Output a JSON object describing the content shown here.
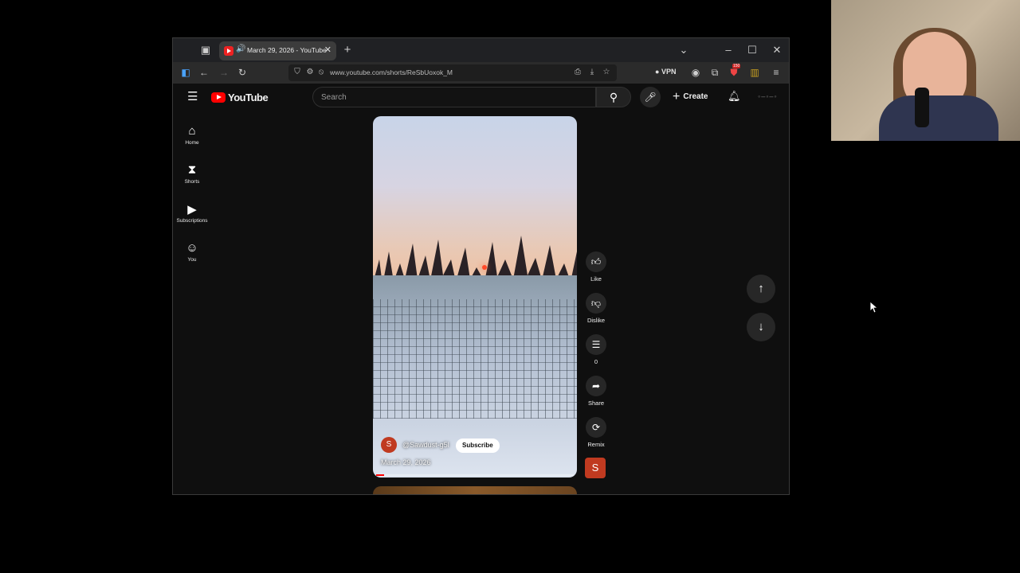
{
  "browser": {
    "tab_title": "March 29, 2026 - YouTube",
    "url": "www.youtube.com/shorts/ReSbUoxok_M",
    "vpn_label": "VPN",
    "extension_badge": "150"
  },
  "youtube": {
    "logo_text": "YouTube",
    "search_placeholder": "Search",
    "create_label": "Create",
    "nav": [
      {
        "label": "Home",
        "icon": "home-icon"
      },
      {
        "label": "Shorts",
        "icon": "shorts-icon"
      },
      {
        "label": "Subscriptions",
        "icon": "subscriptions-icon"
      },
      {
        "label": "You",
        "icon": "you-icon"
      }
    ],
    "short": {
      "channel_initial": "S",
      "channel_handle": "@Sawdust-g5l",
      "subscribe_label": "Subscribe",
      "date": "March 29, 2026",
      "progress": 0.04
    },
    "actions": {
      "like": "Like",
      "dislike": "Dislike",
      "comments_count": "0",
      "share": "Share",
      "remix": "Remix"
    }
  },
  "colors": {
    "brand_red": "#ff0000",
    "background": "#0f0f0f"
  }
}
